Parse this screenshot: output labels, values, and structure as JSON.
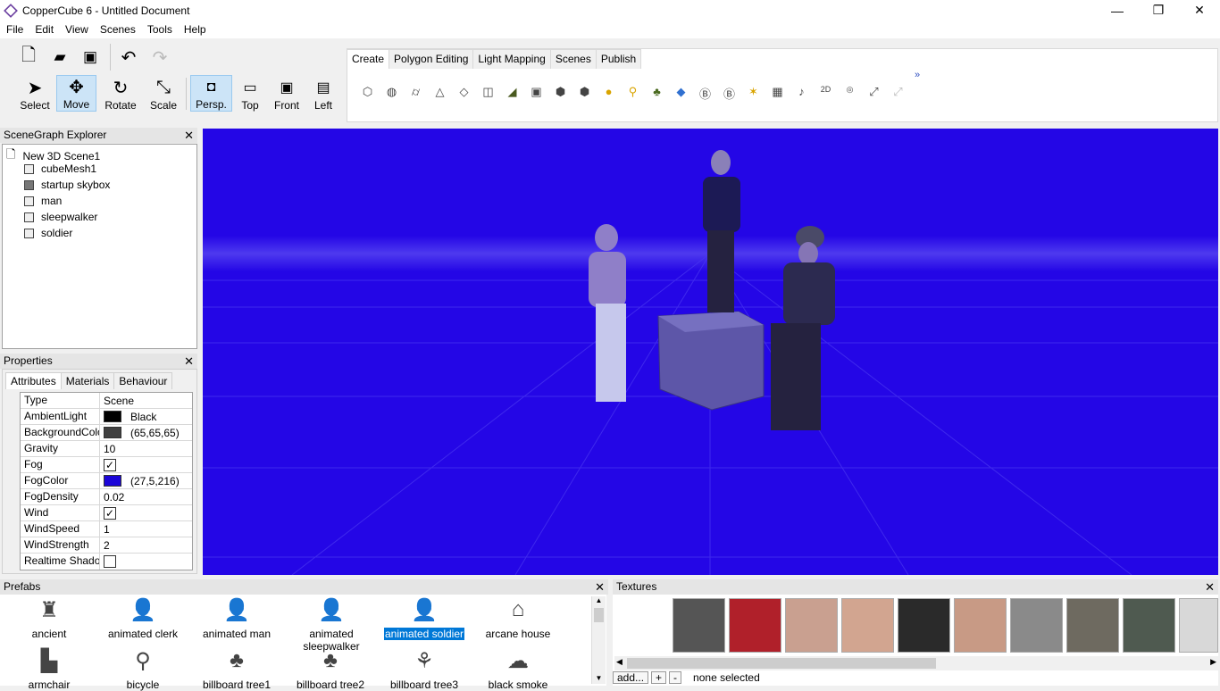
{
  "window": {
    "title": "CopperCube 6 - Untitled Document",
    "minimize": "—",
    "maximize": "❐",
    "close": "✕"
  },
  "menu": [
    "File",
    "Edit",
    "View",
    "Scenes",
    "Tools",
    "Help"
  ],
  "toolbar": {
    "tools": [
      {
        "label": "Select",
        "icon": "pointer-icon"
      },
      {
        "label": "Move",
        "icon": "move-icon"
      },
      {
        "label": "Rotate",
        "icon": "rotate-icon"
      },
      {
        "label": "Scale",
        "icon": "scale-icon"
      }
    ],
    "views": [
      {
        "label": "Persp.",
        "icon": "perspective-view-icon"
      },
      {
        "label": "Top",
        "icon": "top-view-icon"
      },
      {
        "label": "Front",
        "icon": "front-view-icon"
      },
      {
        "label": "Left",
        "icon": "left-view-icon"
      }
    ],
    "active_tool": "Move",
    "active_view": "Persp."
  },
  "ribbon": {
    "tabs": [
      "Create",
      "Polygon Editing",
      "Light Mapping",
      "Scenes",
      "Publish"
    ],
    "active_tab": "Create",
    "more": "»"
  },
  "scenegraph": {
    "title": "SceneGraph Explorer",
    "root": "New 3D Scene1",
    "nodes": [
      "cubeMesh1",
      "startup skybox",
      "man",
      "sleepwalker",
      "soldier"
    ]
  },
  "properties": {
    "title": "Properties",
    "tabs": [
      "Attributes",
      "Materials",
      "Behaviour"
    ],
    "active_tab": "Attributes",
    "rows": [
      {
        "key": "Type",
        "value": "Scene"
      },
      {
        "key": "AmbientLight",
        "value": "Black",
        "color": "#000000"
      },
      {
        "key": "BackgroundColor",
        "value": "(65,65,65)",
        "color": "#414141"
      },
      {
        "key": "Gravity",
        "value": "10"
      },
      {
        "key": "Fog",
        "value": "✓"
      },
      {
        "key": "FogColor",
        "value": "(27,5,216)",
        "color": "#1b05d8"
      },
      {
        "key": "FogDensity",
        "value": "0.02"
      },
      {
        "key": "Wind",
        "value": "✓"
      },
      {
        "key": "WindSpeed",
        "value": "1"
      },
      {
        "key": "WindStrength",
        "value": "2"
      },
      {
        "key": "Realtime Shadows",
        "value": ""
      }
    ]
  },
  "prefabs": {
    "title": "Prefabs",
    "items": [
      {
        "label": "ancient"
      },
      {
        "label": "animated clerk"
      },
      {
        "label": "animated man"
      },
      {
        "label": "animated sleepwalker"
      },
      {
        "label": "animated soldier",
        "selected": true
      },
      {
        "label": "arcane house"
      },
      {
        "label": "armchair"
      },
      {
        "label": "bicycle"
      },
      {
        "label": "billboard tree1"
      },
      {
        "label": "billboard tree2"
      },
      {
        "label": "billboard tree3"
      },
      {
        "label": "black smoke"
      }
    ]
  },
  "textures": {
    "title": "Textures",
    "add": "add...",
    "plus": "+",
    "minus": "-",
    "status": "none selected"
  },
  "colors": {
    "viewport": "#2406e6",
    "selection": "#0078d7"
  }
}
